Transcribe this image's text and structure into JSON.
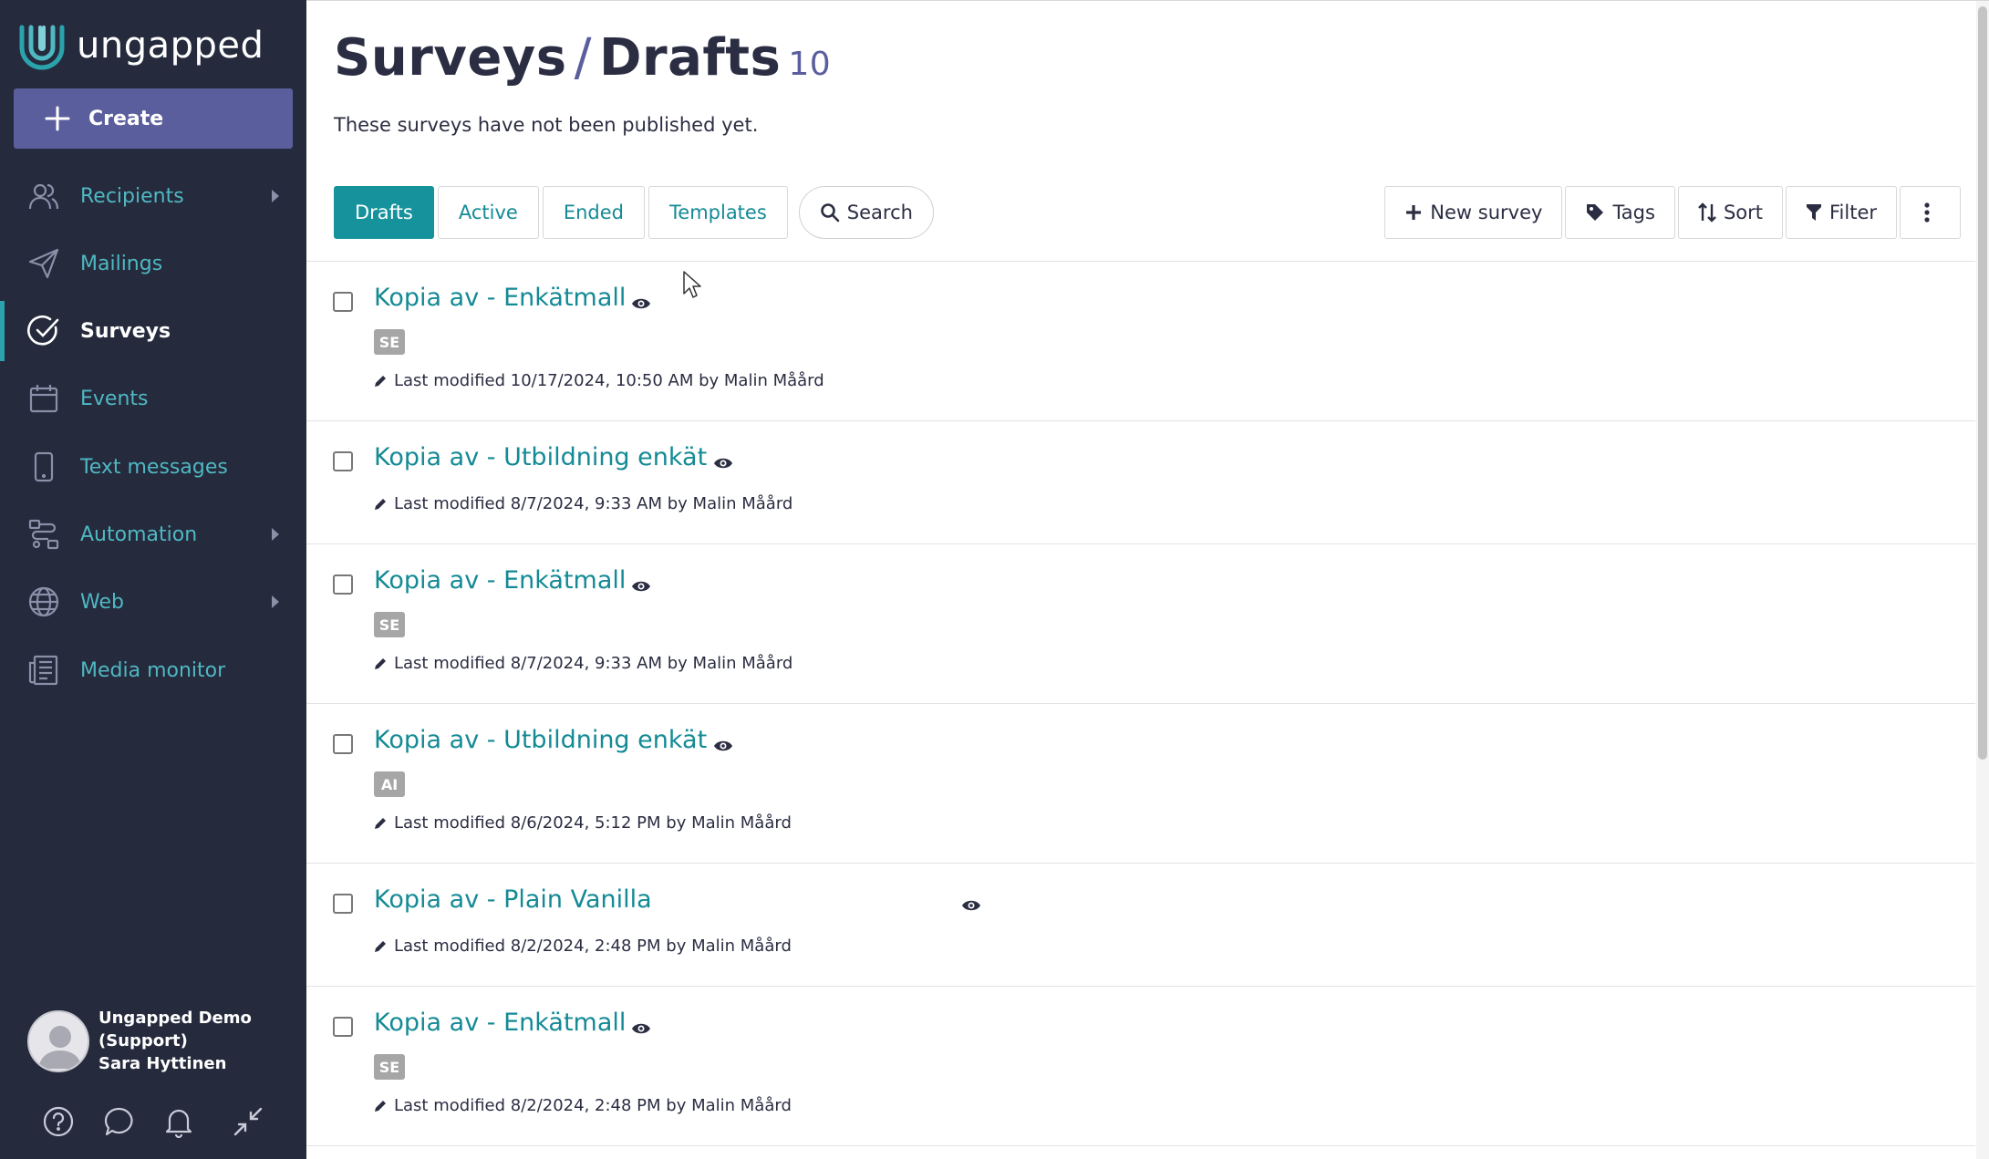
{
  "brand": {
    "name": "ungapped"
  },
  "sidebar": {
    "create_label": "Create",
    "items": [
      {
        "label": "Recipients",
        "icon": "users-icon",
        "has_submenu": true
      },
      {
        "label": "Mailings",
        "icon": "paper-plane-icon",
        "has_submenu": false
      },
      {
        "label": "Surveys",
        "icon": "check-circle-icon",
        "has_submenu": false,
        "active": true
      },
      {
        "label": "Events",
        "icon": "calendar-icon",
        "has_submenu": false
      },
      {
        "label": "Text messages",
        "icon": "mobile-phone-icon",
        "has_submenu": false
      },
      {
        "label": "Automation",
        "icon": "flow-icon",
        "has_submenu": true
      },
      {
        "label": "Web",
        "icon": "globe-icon",
        "has_submenu": true
      },
      {
        "label": "Media monitor",
        "icon": "newspaper-icon",
        "has_submenu": false
      }
    ],
    "profile": {
      "org_line1": "Ungapped Demo",
      "org_line2": "(Support)",
      "user": "Sara Hyttinen"
    },
    "footer_icons": [
      "help-icon",
      "chat-icon",
      "bell-icon",
      "collapse-icon"
    ]
  },
  "page": {
    "title": "Surveys",
    "title_separator": "/",
    "title_section": "Drafts",
    "count": "10",
    "subtitle": "These surveys have not been published yet."
  },
  "tabs": [
    {
      "label": "Drafts",
      "active": true
    },
    {
      "label": "Active",
      "active": false
    },
    {
      "label": "Ended",
      "active": false
    },
    {
      "label": "Templates",
      "active": false
    }
  ],
  "search_label": "Search",
  "toolbar": {
    "new_survey": "New survey",
    "tags": "Tags",
    "sort": "Sort",
    "filter": "Filter"
  },
  "surveys": [
    {
      "name": "Kopia av - Enkätmall",
      "tag": "SE",
      "modified": "Last modified 10/17/2024, 10:50 AM by Malin Måård"
    },
    {
      "name": "Kopia av - Utbildning enkät",
      "tag": "",
      "modified": "Last modified 8/7/2024, 9:33 AM by Malin Måård"
    },
    {
      "name": "Kopia av - Enkätmall",
      "tag": "SE",
      "modified": "Last modified 8/7/2024, 9:33 AM by Malin Måård"
    },
    {
      "name": "Kopia av - Utbildning enkät",
      "tag": "AI",
      "modified": "Last modified 8/6/2024, 5:12 PM by Malin Måård"
    },
    {
      "name": "Kopia av - Plain Vanilla",
      "tag": "",
      "modified": "Last modified 8/2/2024, 2:48 PM by Malin Måård"
    },
    {
      "name": "Kopia av - Enkätmall",
      "tag": "SE",
      "modified": "Last modified 8/2/2024, 2:48 PM by Malin Måård"
    }
  ],
  "colors": {
    "sidebar_bg": "#252a3d",
    "accent_teal": "#16929c",
    "link_teal": "#148a95",
    "create_purple": "#5b5e9c",
    "tag_gray": "#a6a6a6"
  }
}
